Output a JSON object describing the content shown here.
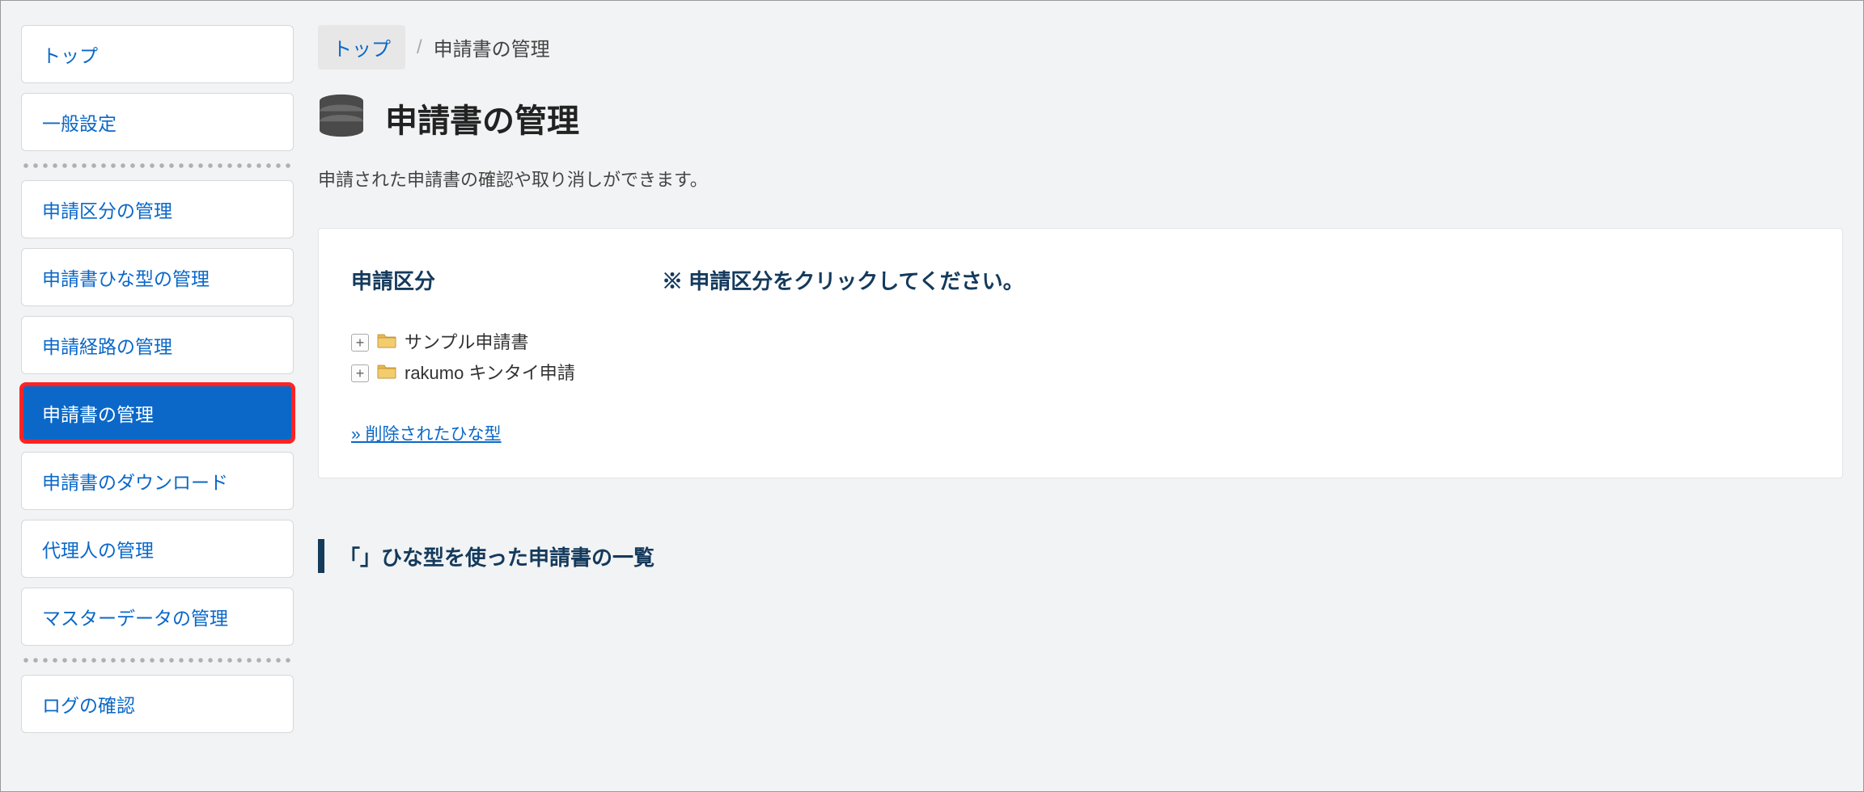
{
  "sidebar": {
    "items": [
      {
        "label": "トップ"
      },
      {
        "label": "一般設定"
      },
      {
        "label": "申請区分の管理"
      },
      {
        "label": "申請書ひな型の管理"
      },
      {
        "label": "申請経路の管理"
      },
      {
        "label": "申請書の管理"
      },
      {
        "label": "申請書のダウンロード"
      },
      {
        "label": "代理人の管理"
      },
      {
        "label": "マスターデータの管理"
      },
      {
        "label": "ログの確認"
      }
    ]
  },
  "breadcrumb": {
    "root": "トップ",
    "sep": "/",
    "current": "申請書の管理"
  },
  "page": {
    "title": "申請書の管理",
    "description": "申請された申請書の確認や取り消しができます。"
  },
  "panel": {
    "heading": "申請区分",
    "message": "※ 申請区分をクリックしてください。",
    "tree": [
      {
        "label": "サンプル申請書"
      },
      {
        "label": "rakumo キンタイ申請"
      }
    ],
    "deleted_link": "» 削除されたひな型"
  },
  "section": {
    "title": "「」ひな型を使った申請書の一覧"
  }
}
